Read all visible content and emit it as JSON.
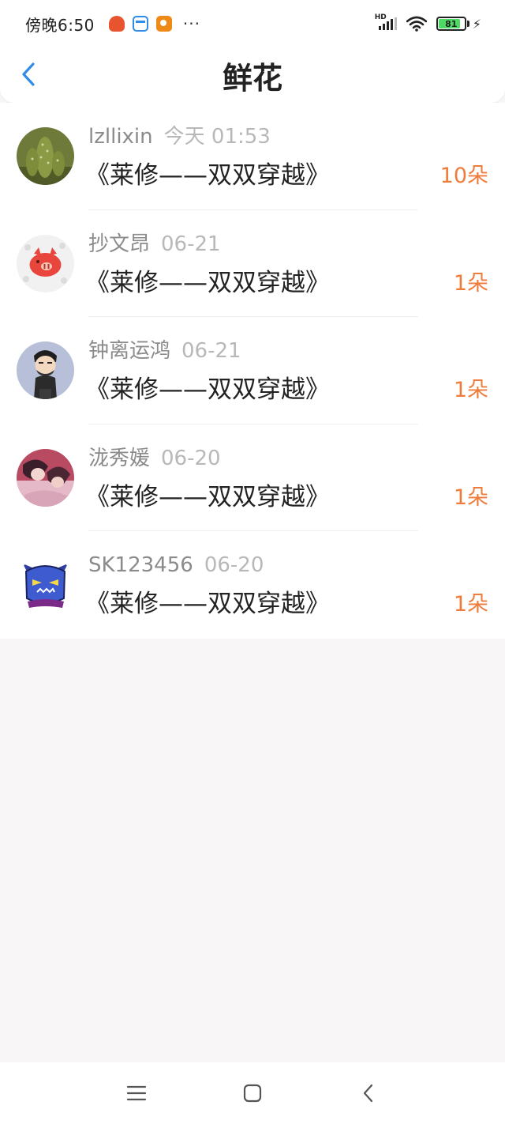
{
  "status_bar": {
    "time": "傍晚6:50",
    "dots": "···",
    "network": "HD",
    "battery": "81"
  },
  "header": {
    "title": "鲜花"
  },
  "records": [
    {
      "username": "lzllixin",
      "time": "今天 01:53",
      "book": "《莱修——双双穿越》",
      "count": "10朵"
    },
    {
      "username": "抄文昂",
      "time": "06-21",
      "book": "《莱修——双双穿越》",
      "count": "1朵"
    },
    {
      "username": "钟离运鸿",
      "time": "06-21",
      "book": "《莱修——双双穿越》",
      "count": "1朵"
    },
    {
      "username": "泷秀媛",
      "time": "06-20",
      "book": "《莱修——双双穿越》",
      "count": "1朵"
    },
    {
      "username": "SK123456",
      "time": "06-20",
      "book": "《莱修——双双穿越》",
      "count": "1朵"
    }
  ],
  "colors": {
    "accent": "#2f8ce8",
    "count": "#ee7d3c",
    "background": "#f8f6f7"
  }
}
